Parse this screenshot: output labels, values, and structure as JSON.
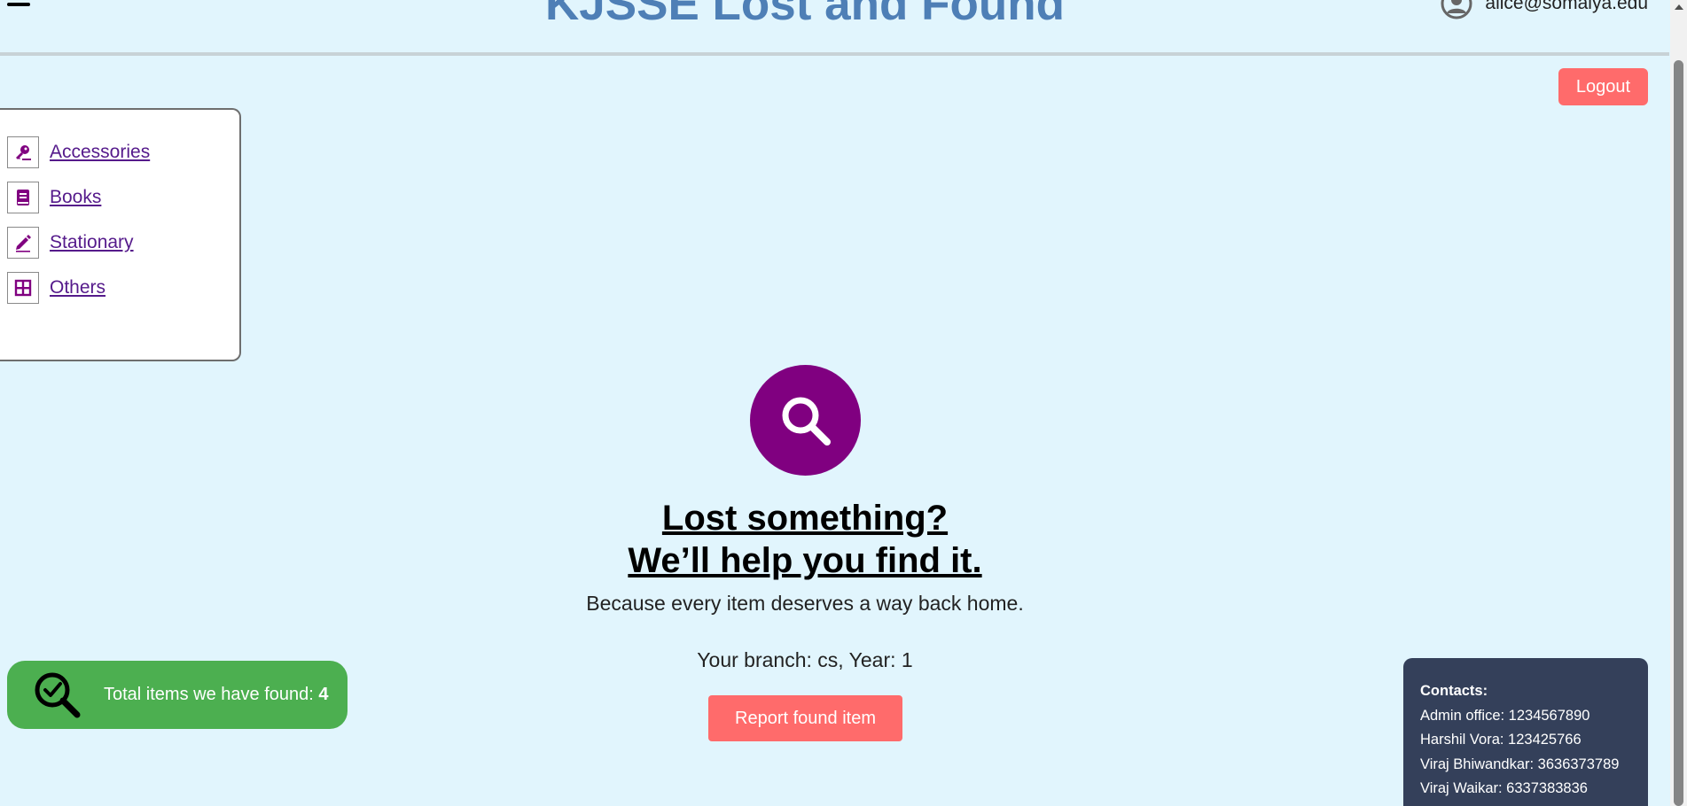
{
  "header": {
    "title": "KJSSE Lost and Found",
    "user_email": "alice@somaiya.edu",
    "logout_label": "Logout"
  },
  "categories": [
    {
      "label": "Accessories",
      "icon": "key-icon"
    },
    {
      "label": "Books",
      "icon": "book-icon"
    },
    {
      "label": "Stationary",
      "icon": "pencil-icon"
    },
    {
      "label": "Others",
      "icon": "grid-icon"
    }
  ],
  "hero": {
    "icon": "search-icon",
    "headline_line1": "Lost something?",
    "headline_line2": "We’ll help you find it.",
    "subtitle": "Because every item deserves a way back home.",
    "branch_info": "Your branch: cs, Year: 1",
    "report_label": "Report found item"
  },
  "found": {
    "label": "Total items we have found:",
    "count": "4"
  },
  "contacts": {
    "title": "Contacts:",
    "lines": [
      "Admin office: 1234567890",
      "Harshil Vora: 123425766",
      "Viraj Bhiwandkar: 3636373789",
      "Viraj Waikar: 6337383836"
    ]
  },
  "colors": {
    "background": "#e1f5fd",
    "title": "#4e7fb6",
    "accent_purple": "#800080",
    "button_red": "#ff6b6b",
    "found_green": "#4caf50",
    "contacts_bg": "#34405a"
  }
}
